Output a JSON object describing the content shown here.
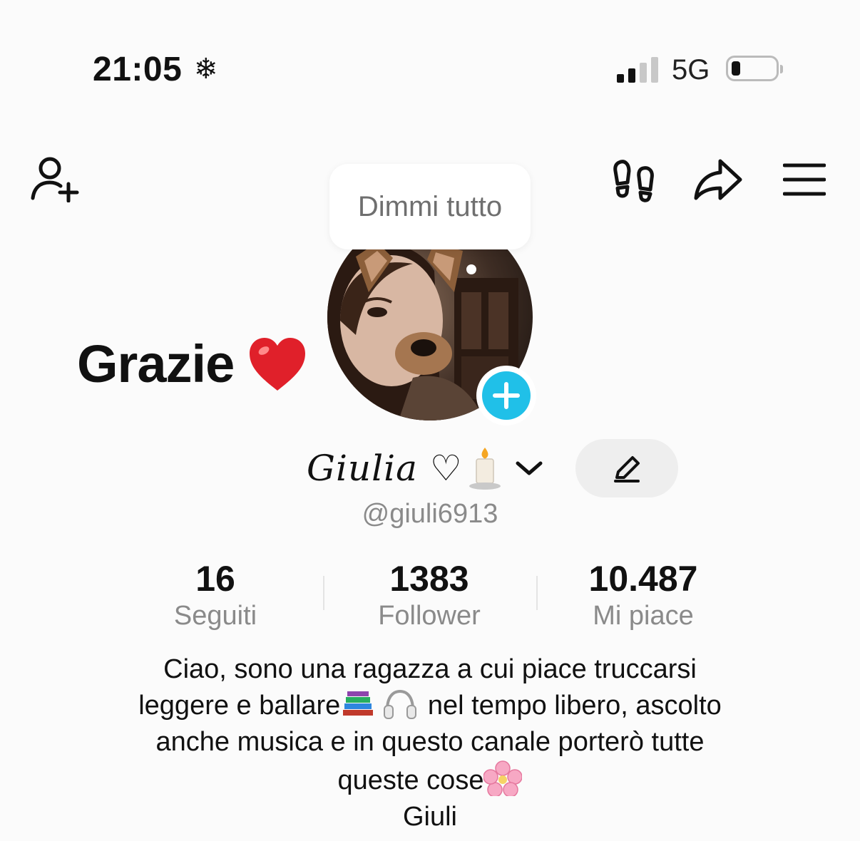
{
  "status_bar": {
    "time": "21:05",
    "weather_icon": "snowflake-icon",
    "network": "5G",
    "battery_level": 0.15
  },
  "top_bar": {
    "add_friend_icon": "person-plus-icon",
    "footprints_icon": "footprints-icon",
    "share_icon": "share-arrow-icon",
    "menu_icon": "hamburger-menu-icon"
  },
  "note_bubble": {
    "text": "Dimmi tutto"
  },
  "sticker_text": "Grazie",
  "profile": {
    "display_name": "Giulia ♡",
    "handle": "@giuli6913"
  },
  "stats": [
    {
      "value": "16",
      "label": "Seguiti"
    },
    {
      "value": "1383",
      "label": "Follower"
    },
    {
      "value": "10.487",
      "label": "Mi piace"
    }
  ],
  "bio": {
    "line1": "Ciao, sono una ragazza a cui piace truccarsi",
    "line2a": "leggere e ballare",
    "line2b": " nel tempo libero, ascolto",
    "line3": "anche musica e in questo canale porterò tutte",
    "line4": "queste cose",
    "line5": "Giuli"
  },
  "colors": {
    "accent": "#20c0e8",
    "text": "#111111",
    "muted": "#8a8a8a",
    "heart": "#e0202a"
  }
}
